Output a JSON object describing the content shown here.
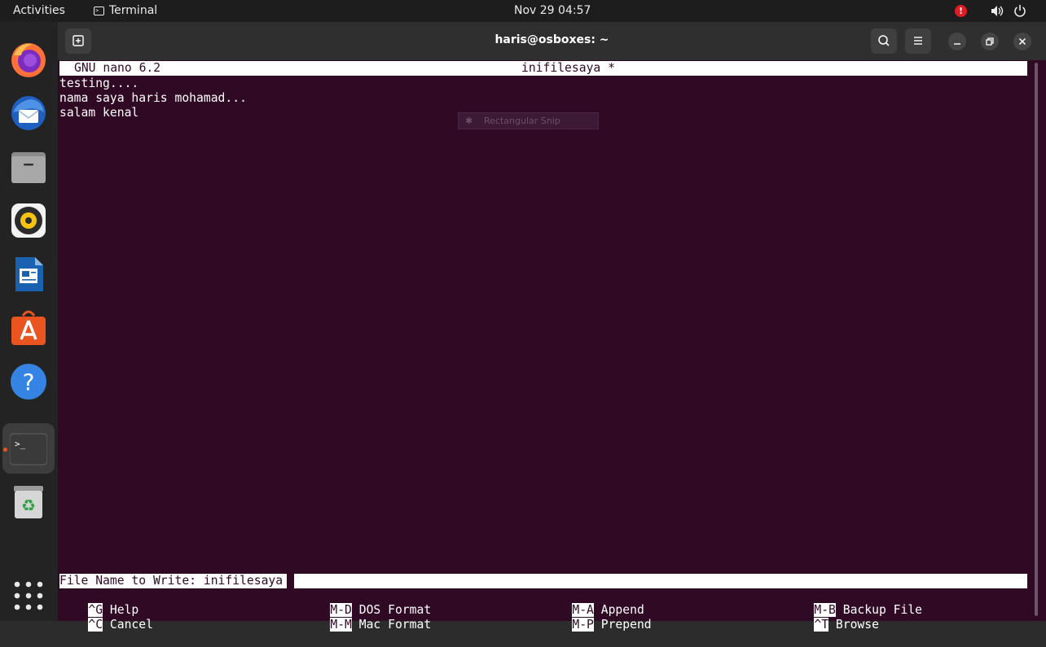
{
  "topbar": {
    "activities": "Activities",
    "app_name": "Terminal",
    "clock": "Nov 29  04:57",
    "alert_symbol": "!"
  },
  "dock": {
    "items": [
      "Firefox",
      "Thunderbird",
      "Files",
      "Rhythmbox",
      "LibreOffice Writer",
      "Ubuntu Software",
      "Help",
      "Terminal",
      "Trash",
      "Show Applications"
    ],
    "terminal_glyph": ">_"
  },
  "window": {
    "title": "haris@osboxes: ~"
  },
  "nano": {
    "version": "GNU nano 6.2",
    "filename": "inifilesaya *",
    "lines": [
      "testing....",
      "nama saya haris mohamad...",
      "salam kenal"
    ],
    "prompt": "File Name to Write: inifilesaya",
    "shortcuts": [
      {
        "key": "^G",
        "label": " Help"
      },
      {
        "key": "^C",
        "label": " Cancel"
      },
      {
        "key": "M-D",
        "label": " DOS Format"
      },
      {
        "key": "M-M",
        "label": " Mac Format"
      },
      {
        "key": "M-A",
        "label": " Append"
      },
      {
        "key": "M-P",
        "label": " Prepend"
      },
      {
        "key": "M-B",
        "label": " Backup File"
      },
      {
        "key": "^T",
        "label": " Browse"
      }
    ]
  },
  "overlay": {
    "snip_label": "Rectangular Snip"
  },
  "colors": {
    "terminal_bg": "#300a24",
    "accent": "#e95420",
    "alert": "#e01b24"
  }
}
